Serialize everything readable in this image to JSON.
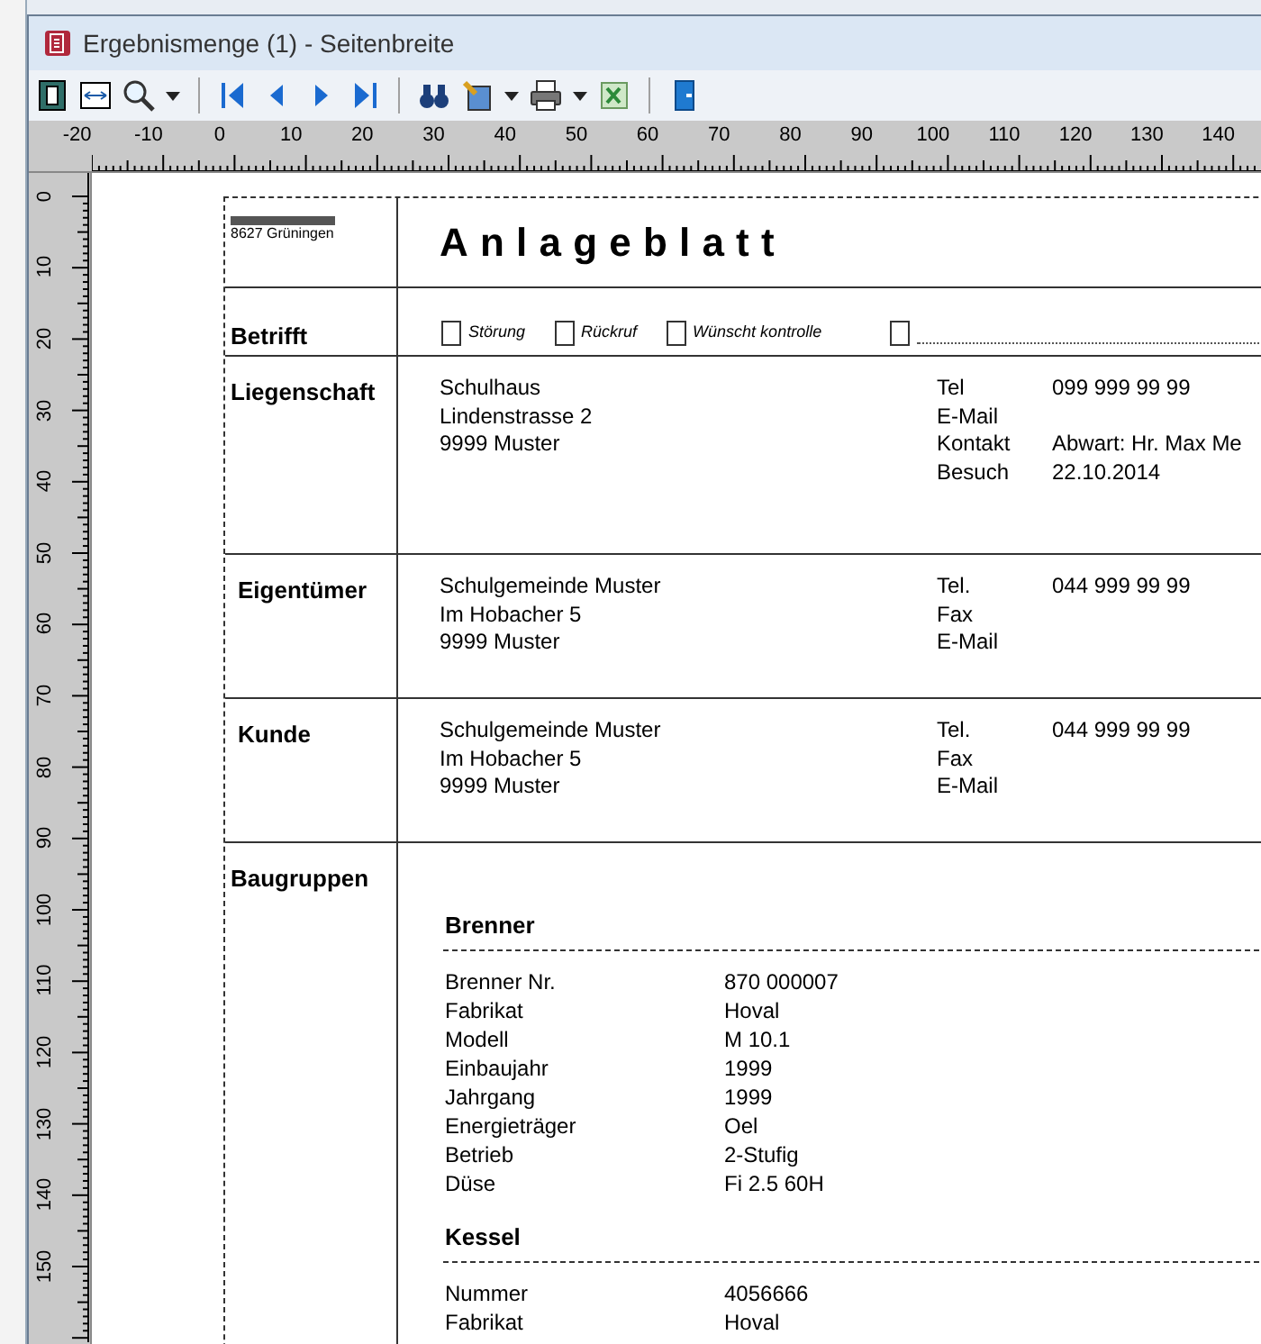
{
  "window": {
    "title": "Ergebnismenge (1) - Seitenbreite"
  },
  "ruler": {
    "horizontal": [
      "-20",
      "-10",
      "0",
      "10",
      "20",
      "30",
      "40",
      "50",
      "60",
      "70",
      "80",
      "90",
      "100",
      "110",
      "120",
      "130",
      "140"
    ],
    "vertical": [
      "0",
      "10",
      "20",
      "30",
      "40",
      "50",
      "60",
      "70",
      "80",
      "90",
      "100",
      "110",
      "120",
      "130",
      "140",
      "150"
    ]
  },
  "report": {
    "sender": "8627 Grüningen",
    "title": "Anlageblatt",
    "subject": {
      "label": "Betrifft",
      "options": [
        {
          "kind": "text",
          "label": "Störung",
          "checked": false
        },
        {
          "kind": "text",
          "label": "Rückruf",
          "checked": false
        },
        {
          "kind": "text",
          "label": "Wünscht kontrolle",
          "checked": false
        },
        {
          "kind": "line",
          "checked": false
        }
      ]
    },
    "sections": [
      {
        "label": "Liegenschaft",
        "address": [
          "Schulhaus",
          "Lindenstrasse 2",
          "9999 Muster"
        ],
        "contacts": [
          {
            "label": "Tel",
            "value": "099 999 99 99"
          },
          {
            "label": "E-Mail"
          },
          {
            "label": "Kontakt",
            "value": "Abwart: Hr. Max Me"
          },
          {
            "label": "Besuch",
            "value": "22.10.2014"
          }
        ]
      },
      {
        "label": "Eigentümer",
        "address": [
          "Schulgemeinde Muster",
          "Im Hobacher 5",
          "9999 Muster"
        ],
        "contacts": [
          {
            "label": "Tel.",
            "value": "044 999 99 99"
          },
          {
            "label": "Fax"
          },
          {
            "label": "E-Mail"
          }
        ]
      },
      {
        "label": "Kunde",
        "address": [
          "Schulgemeinde Muster",
          "Im Hobacher 5",
          "9999 Muster"
        ],
        "contacts": [
          {
            "label": "Tel.",
            "value": "044 999 99 99"
          },
          {
            "label": "Fax"
          },
          {
            "label": "E-Mail"
          }
        ]
      }
    ],
    "components": {
      "label": "Baugruppen",
      "groups": [
        {
          "title": "Brenner",
          "rows": [
            {
              "label": "Brenner Nr.",
              "value": "870 000007"
            },
            {
              "label": "Fabrikat",
              "value": "Hoval"
            },
            {
              "label": "Modell",
              "value": "M 10.1"
            },
            {
              "label": "Einbaujahr",
              "value": "1999"
            },
            {
              "label": "Jahrgang",
              "value": "1999"
            },
            {
              "label": "Energieträger",
              "value": "Oel"
            },
            {
              "label": "Betrieb",
              "value": "2-Stufig"
            },
            {
              "label": "Düse",
              "value": "Fi 2.5 60H"
            }
          ]
        },
        {
          "title": "Kessel",
          "rows": [
            {
              "label": "Nummer",
              "value": "4056666"
            },
            {
              "label": "Fabrikat",
              "value": "Hoval"
            }
          ]
        }
      ]
    }
  }
}
